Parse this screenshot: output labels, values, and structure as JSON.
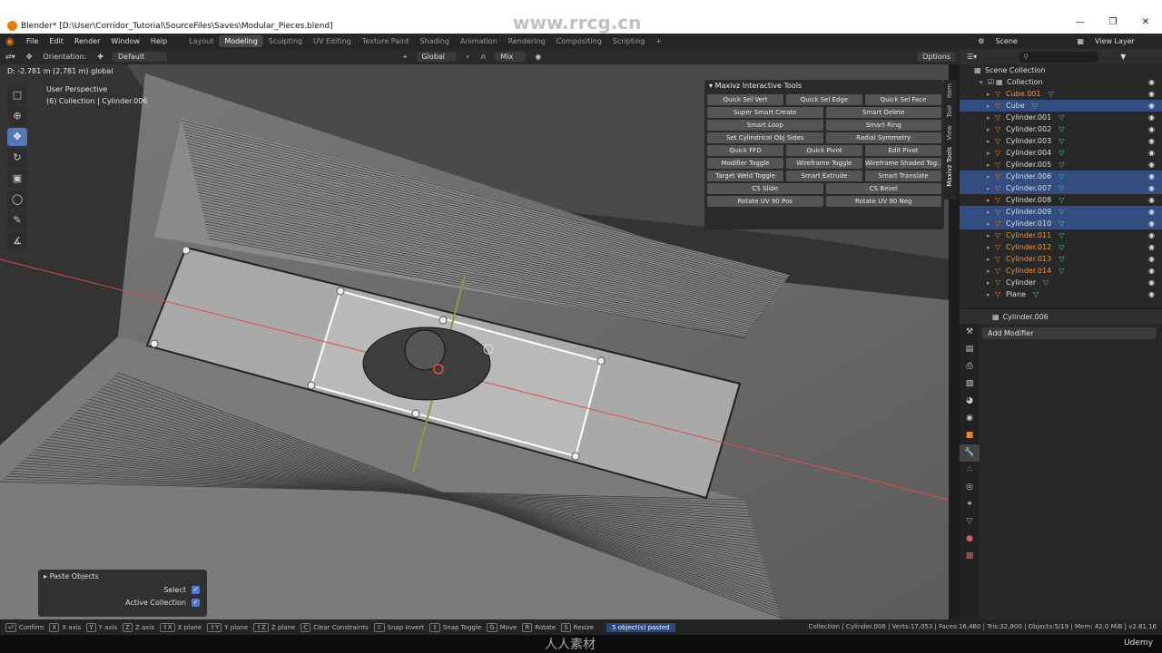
{
  "window": {
    "title": "Blender* [D:\\User\\Corridor_Tutorial\\SourceFiles\\Saves\\Modular_Pieces.blend]",
    "watermark": "www.rrcg.cn",
    "controls": [
      "—",
      "❐",
      "✕"
    ]
  },
  "menu": [
    "File",
    "Edit",
    "Render",
    "Window",
    "Help"
  ],
  "workspaces": [
    "Layout",
    "Modeling",
    "Sculpting",
    "UV Editing",
    "Texture Paint",
    "Shading",
    "Animation",
    "Rendering",
    "Compositing",
    "Scripting",
    "+"
  ],
  "active_workspace": "Modeling",
  "scene": "Scene",
  "view_layer": "View Layer",
  "tool_header": {
    "orientation_label": "Orientation:",
    "orientation_value": "Default",
    "transform_orientation": "Global",
    "snap_mode": "Mix",
    "options": "Options"
  },
  "viewport": {
    "delta_readout": "D: -2.781 m (2.781 m) global",
    "perspective": "User Perspective",
    "collection_info": "(6) Collection | Cylinder.006"
  },
  "toolbar_icons": [
    "select-box-icon",
    "cursor-icon",
    "move-icon",
    "rotate-icon",
    "scale-icon",
    "transform-icon",
    "annotate-icon",
    "measure-icon"
  ],
  "maxivz": {
    "title": "Maxivz Interactive Tools",
    "rows": [
      [
        "Quick Sel Vert",
        "Quick Sel Edge",
        "Quick Sel Face"
      ],
      [
        "Super Smart Create",
        "Smart Delete"
      ],
      [
        "Smart Loop",
        "Smart Ring"
      ],
      [
        "Set Cylindrical Obj Sides",
        "Radial Symmetry"
      ],
      [
        "Quick FFD",
        "Quick Pivot",
        "Edit Pivot"
      ],
      [
        "Modifier Toggle",
        "Wireframe Toggle",
        "Wireframe Shaded Tog..."
      ],
      [
        "Target Weld Toggle",
        "Smart Extrude",
        "Smart Translate"
      ],
      [
        "CS Slide",
        "CS Bevel"
      ],
      [
        "Rotate UV 90 Pos",
        "Rotate UV 90 Neg"
      ]
    ]
  },
  "side_tabs": [
    "Item",
    "Tool",
    "View",
    "Maxivz Tools"
  ],
  "paste_panel": {
    "title": "Paste Objects",
    "select_label": "Select",
    "active_collection_label": "Active Collection"
  },
  "outliner": {
    "search_placeholder": "",
    "scene_collection": "Scene Collection",
    "collection": "Collection",
    "items": [
      {
        "name": "Cube.001",
        "orange": true,
        "selected": false
      },
      {
        "name": "Cube",
        "orange": false,
        "selected": true
      },
      {
        "name": "Cylinder.001",
        "orange": false,
        "selected": false
      },
      {
        "name": "Cylinder.002",
        "orange": false,
        "selected": false
      },
      {
        "name": "Cylinder.003",
        "orange": false,
        "selected": false
      },
      {
        "name": "Cylinder.004",
        "orange": false,
        "selected": false
      },
      {
        "name": "Cylinder.005",
        "orange": false,
        "selected": false
      },
      {
        "name": "Cylinder.006",
        "orange": false,
        "selected": true
      },
      {
        "name": "Cylinder.007",
        "orange": false,
        "selected": true
      },
      {
        "name": "Cylinder.008",
        "orange": false,
        "selected": false
      },
      {
        "name": "Cylinder.009",
        "orange": false,
        "selected": true
      },
      {
        "name": "Cylinder.010",
        "orange": false,
        "selected": true
      },
      {
        "name": "Cylinder.011",
        "orange": true,
        "selected": false
      },
      {
        "name": "Cylinder.012",
        "orange": true,
        "selected": false
      },
      {
        "name": "Cylinder.013",
        "orange": true,
        "selected": false
      },
      {
        "name": "Cylinder.014",
        "orange": true,
        "selected": false
      },
      {
        "name": "Cylinder",
        "orange": false,
        "selected": false
      },
      {
        "name": "Plane",
        "orange": false,
        "selected": false
      }
    ]
  },
  "properties": {
    "object_name": "Cylinder.006",
    "add_modifier": "Add Modifier"
  },
  "statusbar": {
    "keys": [
      {
        "key": "⏎",
        "label": "Confirm"
      },
      {
        "key": "X",
        "label": "X axis"
      },
      {
        "key": "Y",
        "label": "Y axis"
      },
      {
        "key": "Z",
        "label": "Z axis"
      },
      {
        "key": "⇧X",
        "label": "X plane"
      },
      {
        "key": "⇧Y",
        "label": "Y plane"
      },
      {
        "key": "⇧Z",
        "label": "Z plane"
      },
      {
        "key": "C",
        "label": "Clear Constraints"
      },
      {
        "key": "⇧",
        "label": "Snap Invert"
      },
      {
        "key": "⇧",
        "label": "Snap Toggle"
      },
      {
        "key": "G",
        "label": "Move"
      },
      {
        "key": "R",
        "label": "Rotate"
      },
      {
        "key": "S",
        "label": "Resize"
      }
    ],
    "pasted": "5 object(s) pasted",
    "stats": "Collection | Cylinder.006 | Verts:17,053 | Faces:16,460 | Tris:32,800 | Objects:5/19 | Mem: 42.0 MiB | v2.81.16"
  },
  "brand": "Udemy",
  "bottom_watermark": "人人素材"
}
